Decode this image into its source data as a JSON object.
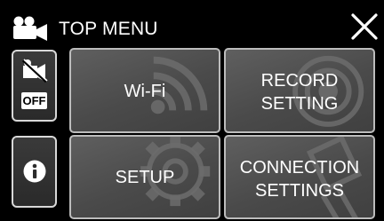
{
  "header": {
    "title": "TOP MENU",
    "icon": "video-camera-icon",
    "close_icon": "close-icon"
  },
  "side": {
    "mute_icon": "sound-off-icon",
    "mute_badge": "OFF",
    "info_icon": "info-icon"
  },
  "tiles": [
    {
      "line1": "Wi-Fi",
      "line2": "",
      "icon": "wifi-icon"
    },
    {
      "line1": "RECORD",
      "line2": "SETTING",
      "icon": "record-icon"
    },
    {
      "line1": "SETUP",
      "line2": "",
      "icon": "gear-icon"
    },
    {
      "line1": "CONNECTION",
      "line2": "SETTINGS",
      "icon": "connection-icon"
    }
  ]
}
